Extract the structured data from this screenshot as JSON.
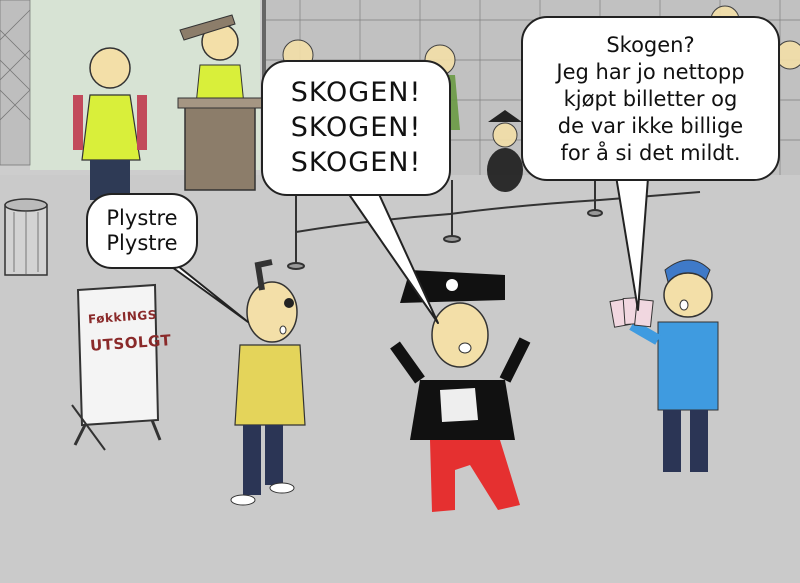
{
  "scene": {
    "background": "#cfcfcf",
    "accent_colors": {
      "yellow_vest": "#d9ef3a",
      "pirate_pants": "#e53030",
      "kid_shirt": "#3f9be0",
      "cap": "#3f7ac8",
      "sign_text": "#8a2a2a"
    }
  },
  "speech": {
    "plystre": "Plystre\nPlystre",
    "skogen": "SKOGEN!\nSKOGEN!\nSKOGEN!",
    "tickets": "Skogen?\nJeg har jo nettopp\nkjøpt billetter og\nde var ikke billige\nfor å si det mildt."
  },
  "sign": {
    "line1": "FøkkINGS",
    "line2": "UTSOLGT"
  }
}
